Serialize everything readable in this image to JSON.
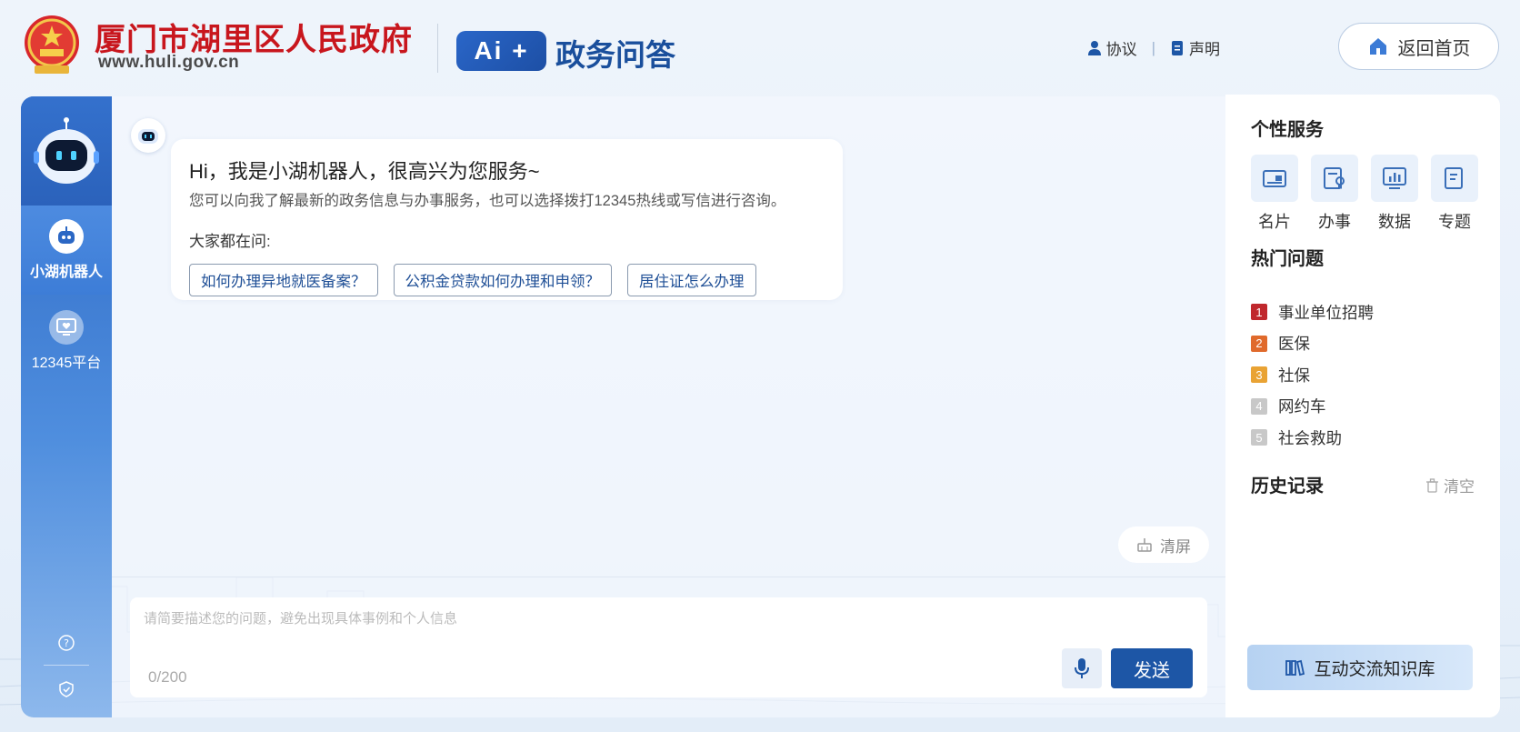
{
  "header": {
    "gov_name": "厦门市湖里区人民政府",
    "gov_url": "www.huli.gov.cn",
    "ai_badge": "Ai +",
    "product_title": "政务问答",
    "links": [
      {
        "label": "协议",
        "icon": "user-icon"
      },
      {
        "label": "声明",
        "icon": "document-icon"
      }
    ],
    "home_label": "返回首页"
  },
  "leftnav": {
    "items": [
      {
        "label": "小湖机器人",
        "icon": "robot-icon",
        "active": true
      },
      {
        "label": "12345平台",
        "icon": "monitor-heart-icon",
        "active": false
      }
    ],
    "bottom_icons": [
      "help-icon",
      "shield-icon"
    ]
  },
  "chat": {
    "greeting": "Hi，我是小湖机器人，很高兴为您服务~",
    "intro": "您可以向我了解最新的政务信息与办事服务，也可以选择拨打12345热线或写信进行咨询。",
    "ask_label": "大家都在问:",
    "suggestions": [
      "如何办理异地就医备案？",
      "公积金贷款如何办理和申领？",
      "居住证怎么办理"
    ],
    "clear_label": "清屏",
    "input_placeholder": "请简要描述您的问题，避免出现具体事例和个人信息",
    "input_value": "",
    "char_count": "0/200",
    "send_label": "发送"
  },
  "rightpanel": {
    "services_title": "个性服务",
    "services": [
      {
        "label": "名片",
        "icon": "card-icon"
      },
      {
        "label": "办事",
        "icon": "certificate-icon"
      },
      {
        "label": "数据",
        "icon": "chart-icon"
      },
      {
        "label": "专题",
        "icon": "topic-icon"
      }
    ],
    "hot_title": "热门问题",
    "hot_items": [
      {
        "rank": "1",
        "label": "事业单位招聘",
        "color": "#c0282d"
      },
      {
        "rank": "2",
        "label": "医保",
        "color": "#e06a2c"
      },
      {
        "rank": "3",
        "label": "社保",
        "color": "#e9a334"
      },
      {
        "rank": "4",
        "label": "网约车",
        "color": "#c8c8c8"
      },
      {
        "rank": "5",
        "label": "社会救助",
        "color": "#c8c8c8"
      }
    ],
    "history_title": "历史记录",
    "history_clear": "清空",
    "kb_label": "互动交流知识库"
  },
  "colors": {
    "primary": "#1d56a6",
    "brand_red": "#c8161d",
    "nav_blue": "#2b67c4"
  }
}
